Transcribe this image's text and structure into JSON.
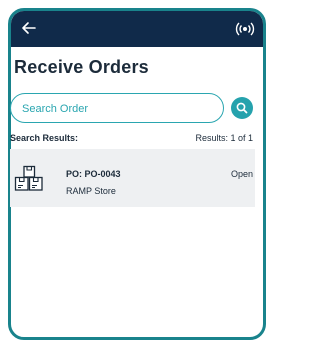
{
  "header": {
    "back_icon": "arrow-left-icon",
    "broadcast_icon": "broadcast-icon"
  },
  "page": {
    "title": "Receive Orders"
  },
  "search": {
    "placeholder": "Search Order",
    "value": "",
    "button_icon": "search-icon",
    "accent_color": "#25a2ad"
  },
  "results": {
    "label": "Search Results:",
    "count_text": "Results:  1  of  1",
    "items": [
      {
        "po": "PO: PO-0043",
        "store": "RAMP Store",
        "status": "Open",
        "icon": "boxes-icon"
      }
    ]
  },
  "colors": {
    "header_bg": "#102a4a",
    "frame": "#19838c",
    "row_bg": "#eef0f2"
  }
}
